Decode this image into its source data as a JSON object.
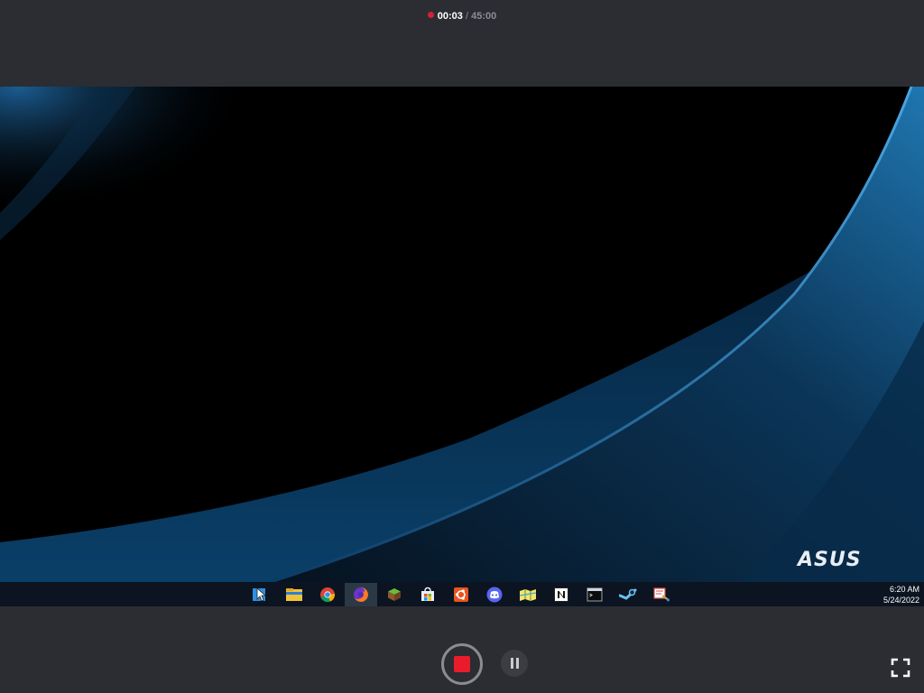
{
  "recording": {
    "elapsed": "00:03",
    "separator": "/",
    "limit": "45:00",
    "indicator_color": "#d81e3c"
  },
  "desktop": {
    "wallpaper_brand": "ASUS",
    "taskbar": {
      "items": [
        {
          "name": "snipping-tool-icon",
          "active": false
        },
        {
          "name": "file-explorer-icon",
          "active": false
        },
        {
          "name": "chrome-icon",
          "active": false
        },
        {
          "name": "firefox-icon",
          "active": true
        },
        {
          "name": "minecraft-icon",
          "active": false
        },
        {
          "name": "microsoft-store-icon",
          "active": false
        },
        {
          "name": "ubuntu-icon",
          "active": false
        },
        {
          "name": "discord-icon",
          "active": false
        },
        {
          "name": "maps-icon",
          "active": false
        },
        {
          "name": "notion-icon",
          "active": false
        },
        {
          "name": "terminal-icon",
          "active": false
        },
        {
          "name": "steam-icon",
          "active": false
        },
        {
          "name": "paint-icon",
          "active": false
        }
      ],
      "clock_time": "6:20 AM",
      "clock_date": "5/24/2022"
    }
  },
  "controls": {
    "stop_color": "#ea1c2c",
    "stop_icon": "stop-icon",
    "pause_icon": "pause-icon",
    "fullscreen_icon": "fullscreen-icon"
  }
}
